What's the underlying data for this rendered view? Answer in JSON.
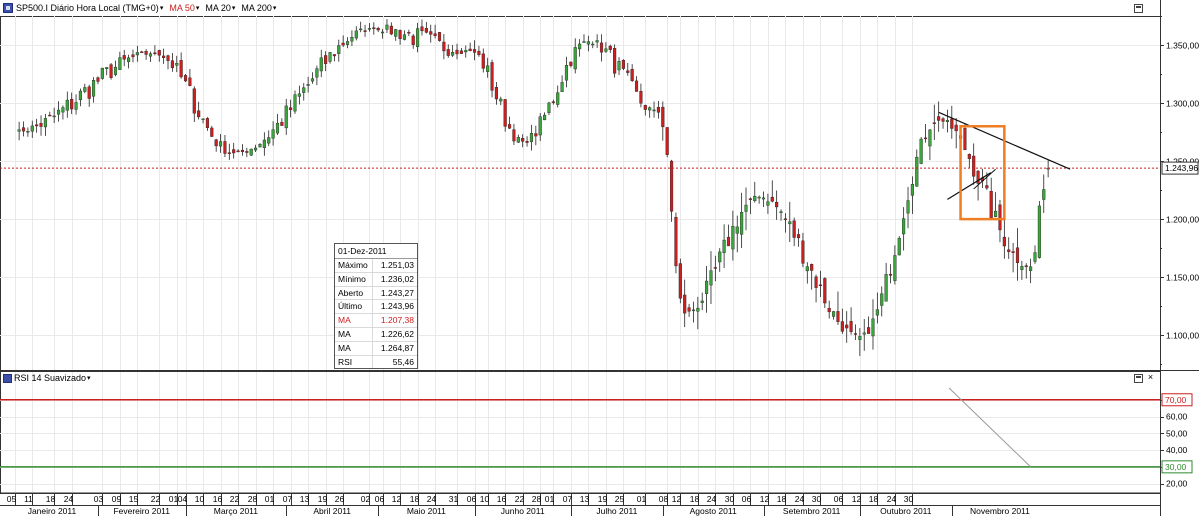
{
  "toolbar": {
    "symbol_label": "SP500.I Diário Hora Local (TMG+0)",
    "ma50_label": "MA 50",
    "ma20_label": "MA 20",
    "ma200_label": "MA 200",
    "caret": "▾"
  },
  "indicator": {
    "title": "RSI 14 Suavizado",
    "caret": "▾"
  },
  "window_buttons": {
    "close": "×"
  },
  "info_box": {
    "date": "01-Dez-2011",
    "rows": [
      {
        "key": "Máximo",
        "value": "1.251,03"
      },
      {
        "key": "Mínimo",
        "value": "1.236,02"
      },
      {
        "key": "Aberto",
        "value": "1.243,27"
      },
      {
        "key": "Último",
        "value": "1.243,96"
      },
      {
        "key": "MA",
        "value": "1.207,38",
        "color": "#cc2020"
      },
      {
        "key": "MA",
        "value": "1.226,62"
      },
      {
        "key": "MA",
        "value": "1.264,87"
      },
      {
        "key": "RSI",
        "value": "55,46"
      }
    ]
  },
  "colors": {
    "up": "#3aa53a",
    "down": "#cc1f1f",
    "ma50": "#d93030",
    "ma20": "#8c8c8c",
    "ma200": "#1a1a1a",
    "rsi": "#111111",
    "rsi_upper": "#cc1f1f",
    "rsi_lower": "#2e8b2e",
    "last_price_line": "#cc1f1f",
    "highlight_box": "#ef7d22"
  },
  "chart_data": [
    {
      "type": "candlestick",
      "title": "SP500.I Diário Hora Local (TMG+0)",
      "ylim": [
        1070,
        1375
      ],
      "y_ticks": [
        1100,
        1150,
        1200,
        1250,
        1300,
        1350
      ],
      "y_tick_labels": [
        "1.100,00",
        "1.150,00",
        "1.200,00",
        "1.250,00",
        "1.300,00",
        "1.350,00"
      ],
      "last_price": 1243.96,
      "last_price_label": "1.243,96",
      "series": [
        {
          "name": "MA 50",
          "values": "computed"
        },
        {
          "name": "MA 20",
          "values": "computed"
        },
        {
          "name": "MA 200",
          "values": "computed"
        }
      ],
      "key_points": [
        {
          "date": "2011-01-05",
          "close": 1276
        },
        {
          "date": "2011-02-18",
          "close": 1343
        },
        {
          "date": "2011-03-16",
          "close": 1257
        },
        {
          "date": "2011-04-29",
          "close": 1364
        },
        {
          "date": "2011-05-31",
          "close": 1345
        },
        {
          "date": "2011-06-16",
          "close": 1267
        },
        {
          "date": "2011-07-07",
          "close": 1353
        },
        {
          "date": "2011-07-29",
          "close": 1292
        },
        {
          "date": "2011-08-08",
          "close": 1119
        },
        {
          "date": "2011-08-31",
          "close": 1219
        },
        {
          "date": "2011-10-03",
          "close": 1099
        },
        {
          "date": "2011-10-27",
          "close": 1285
        },
        {
          "date": "2011-11-25",
          "close": 1159
        },
        {
          "date": "2011-12-01",
          "close": 1244
        }
      ],
      "annotations": [
        "trendline-upper",
        "trendline-lower",
        "highlight-box"
      ]
    },
    {
      "type": "line",
      "title": "RSI 14 Suavizado",
      "ylim": [
        15,
        80
      ],
      "y_ticks": [
        20,
        30,
        40,
        50,
        60,
        70
      ],
      "y_tick_labels": [
        "20,00",
        "30,00",
        "40,00",
        "50,00",
        "60,00",
        "70,00"
      ],
      "overbought": 70,
      "oversold": 30,
      "last_value": 55.46
    }
  ],
  "x_axis": {
    "day_ticks": [
      "05",
      "11",
      "18",
      "24",
      "03",
      "09",
      "15",
      "22",
      "01",
      "04",
      "10",
      "16",
      "22",
      "28",
      "01",
      "07",
      "13",
      "19",
      "26",
      "02",
      "06",
      "12",
      "18",
      "24",
      "31",
      "06",
      "10",
      "16",
      "22",
      "28",
      "01",
      "07",
      "13",
      "19",
      "25",
      "01",
      "08",
      "12",
      "18",
      "24",
      "30",
      "06",
      "12",
      "18",
      "24",
      "30",
      "06",
      "12",
      "18",
      "24",
      "30"
    ],
    "months": [
      "Janeiro 2011",
      "Fevereiro 2011",
      "Março 2011",
      "Abril 2011",
      "Maio 2011",
      "Junho 2011",
      "Julho 2011",
      "Agosto 2011",
      "Setembro 2011",
      "Outubro 2011",
      "Novembro 2011"
    ]
  },
  "day_tick_labels": [
    "05",
    "11",
    "18",
    "24",
    "03",
    "09",
    "15",
    "22",
    "01",
    "04",
    "10",
    "16",
    "22",
    "28",
    "01",
    "07",
    "13",
    "19",
    "26",
    "02",
    "06",
    "12",
    "18",
    "24",
    "31",
    "06",
    "10",
    "16",
    "22",
    "28",
    "01",
    "07",
    "13",
    "19",
    "25",
    "01",
    "08",
    "12",
    "18",
    "24",
    "30",
    "06",
    "12",
    "18",
    "24",
    "30",
    "06",
    "12",
    "18",
    "24",
    "30"
  ],
  "month_labels": [
    "Janeiro 2011",
    "Fevereiro 2011",
    "Março 2011",
    "Abril 2011",
    "Maio 2011",
    "Junho 2011",
    "Julho 2011",
    "Agosto 2011",
    "Setembro 2011",
    "Outubro 2011",
    "Novembro 2011"
  ]
}
